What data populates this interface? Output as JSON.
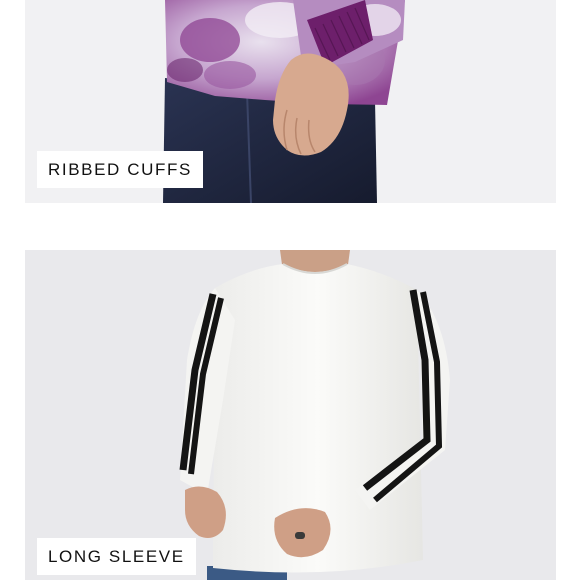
{
  "panels": [
    {
      "caption": "RIBBED CUFFS",
      "image": "tie-dye-shirt-ribbed-cuff-photo"
    },
    {
      "caption": "LONG SLEEVE",
      "image": "white-long-sleeve-shirt-black-stripes-photo"
    }
  ],
  "colors": {
    "tie_dye_purple": "#7a2f7e",
    "cuff_purple": "#6d1f6b",
    "denim": "#1f2640",
    "shirt_white": "#f7f7f5",
    "stripe_black": "#141414",
    "caption_bg": "#ffffff"
  }
}
